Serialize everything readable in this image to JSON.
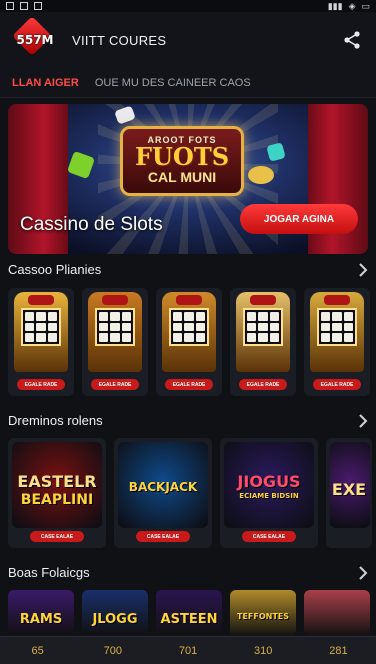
{
  "app": {
    "logo_text": "557M",
    "title": "VIITT COURES"
  },
  "subnav": {
    "active_tab": "LLAN AIGER",
    "inactive_tab": "OUE MU DES CAINEER CAOS"
  },
  "banner": {
    "logo_line1": "AROOT FOTS",
    "logo_line2": "FUOTS",
    "logo_line3": "CAL MUNI",
    "title": "Cassino de Slots",
    "cta": "JOGAR AGINA"
  },
  "sections": [
    {
      "title": "Cassoo Plianies",
      "cards": [
        {
          "pill": "EGALE RADE",
          "accent": "#e9b43c"
        },
        {
          "pill": "EGALE RADE",
          "accent": "#c97a22"
        },
        {
          "pill": "EGALE RADE",
          "accent": "#d08a2b"
        },
        {
          "pill": "EGALE RADE",
          "accent": "#e6c06a"
        },
        {
          "pill": "EGALE RADE",
          "accent": "#d7aa3c"
        }
      ]
    },
    {
      "title": "Dreminos rolens",
      "cards": [
        {
          "word1": "EASTELR",
          "word2": "BEAPLINI",
          "pill": "CASE EALAE",
          "bg": "#7a1010"
        },
        {
          "word1": "BACKJACK",
          "word2": "",
          "pill": "CASE EALAE",
          "bg": "#0f4a8a"
        },
        {
          "word1": "JIOGUS",
          "word2": "ECIAME BIDSIN",
          "pill": "CASE EALAE",
          "bg": "#2a1a5e"
        },
        {
          "word1": "EXE",
          "word2": "",
          "pill": "",
          "bg": "#4a1a6e"
        }
      ]
    },
    {
      "title": "Boas Folaicgs",
      "cards": [
        {
          "word": "RAMS",
          "bg": "#3a1a6a"
        },
        {
          "word": "JLOGG",
          "bg": "#1a2f6a"
        },
        {
          "word": "ASTEEN",
          "bg": "#2a1550"
        },
        {
          "word": "TEFFONTES",
          "bg": "#b08a2a"
        },
        {
          "word": "",
          "bg": "#a8404a"
        }
      ]
    }
  ],
  "bottom_numbers": [
    "65",
    "700",
    "701",
    "310",
    "281"
  ]
}
